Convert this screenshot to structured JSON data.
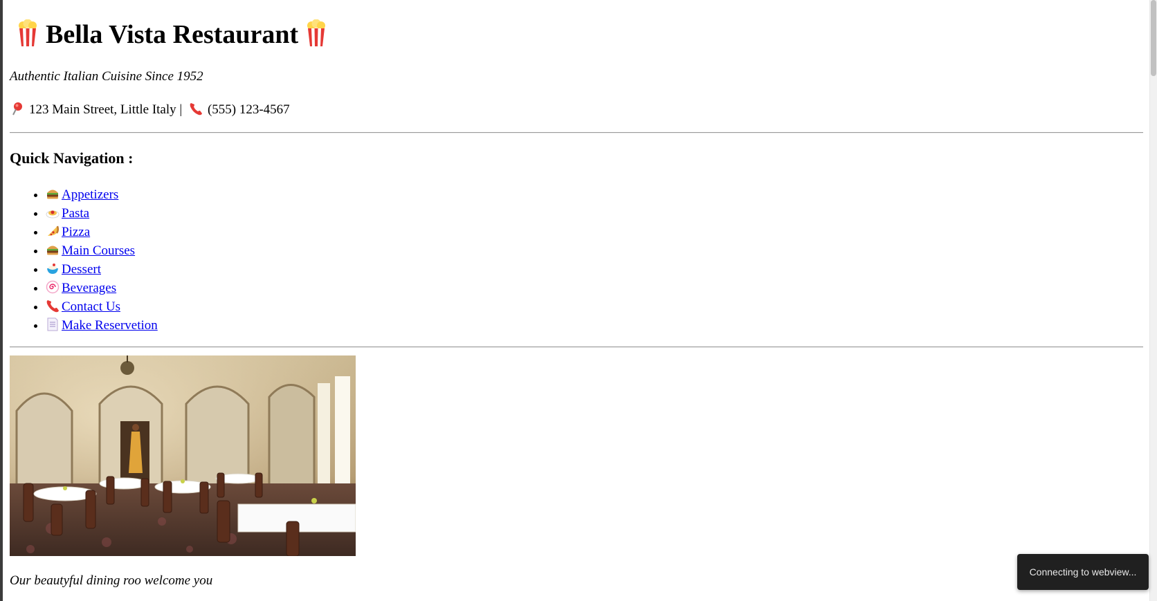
{
  "header": {
    "title": "Bella Vista Restaurant",
    "title_icon": "popcorn-icon",
    "tagline": "Authentic Italian Cuisine Since 1952",
    "address_icon": "pushpin-icon",
    "address": "123 Main Street, Little Italy |",
    "phone_icon": "telephone-icon",
    "phone": "(555) 123-4567"
  },
  "nav": {
    "heading": "Quick Navigation :",
    "items": [
      {
        "icon": "burger-icon",
        "label": "Appetizers"
      },
      {
        "icon": "pasta-icon",
        "label": "Pasta"
      },
      {
        "icon": "pizza-icon",
        "label": "Pizza"
      },
      {
        "icon": "burger-icon",
        "label": "Main Courses"
      },
      {
        "icon": "dessert-icon",
        "label": "Dessert"
      },
      {
        "icon": "swirl-icon",
        "label": "Beverages"
      },
      {
        "icon": "telephone-icon",
        "label": "Contact Us"
      },
      {
        "icon": "page-icon",
        "label": "Make Reservetion"
      }
    ]
  },
  "gallery": {
    "caption": "Our beautyful dining roo welcome you"
  },
  "toast": {
    "message": "Connecting to webview..."
  },
  "colors": {
    "link": "#0000ee",
    "toast_bg": "#202020"
  }
}
